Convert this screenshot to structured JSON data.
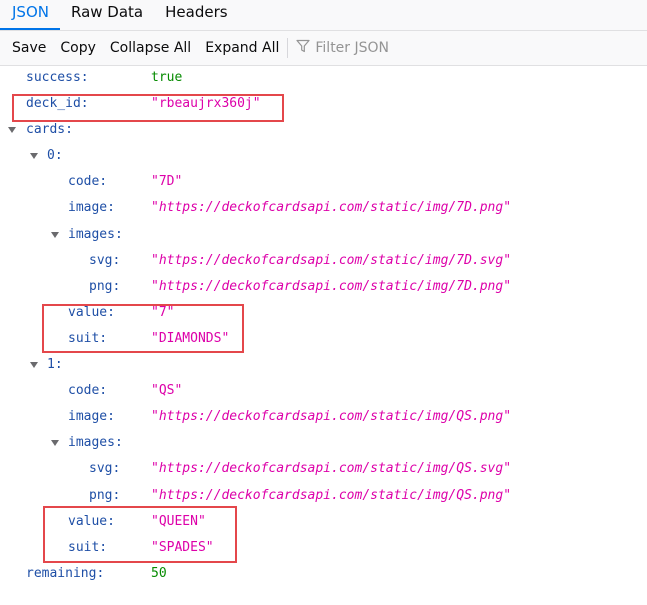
{
  "tabs": {
    "json": "JSON",
    "raw": "Raw Data",
    "headers": "Headers"
  },
  "toolbar": {
    "save": "Save",
    "copy": "Copy",
    "collapse_all": "Collapse All",
    "expand_all": "Expand All",
    "filter_placeholder": "Filter JSON"
  },
  "json": {
    "success": {
      "key": "success:",
      "value": "true"
    },
    "deck_id": {
      "key": "deck_id:",
      "value": "\"rbeaujrx360j\""
    },
    "cards": {
      "key": "cards:"
    },
    "card0": {
      "index": "0:",
      "code": {
        "key": "code:",
        "value": "\"7D\""
      },
      "image": {
        "key": "image:",
        "value": "\"https://deckofcardsapi.com/static/img/7D.png\""
      },
      "images": {
        "key": "images:"
      },
      "svg": {
        "key": "svg:",
        "value": "\"https://deckofcardsapi.com/static/img/7D.svg\""
      },
      "png": {
        "key": "png:",
        "value": "\"https://deckofcardsapi.com/static/img/7D.png\""
      },
      "value": {
        "key": "value:",
        "value": "\"7\""
      },
      "suit": {
        "key": "suit:",
        "value": "\"DIAMONDS\""
      }
    },
    "card1": {
      "index": "1:",
      "code": {
        "key": "code:",
        "value": "\"QS\""
      },
      "image": {
        "key": "image:",
        "value": "\"https://deckofcardsapi.com/static/img/QS.png\""
      },
      "images": {
        "key": "images:"
      },
      "svg": {
        "key": "svg:",
        "value": "\"https://deckofcardsapi.com/static/img/QS.svg\""
      },
      "png": {
        "key": "png:",
        "value": "\"https://deckofcardsapi.com/static/img/QS.png\""
      },
      "value": {
        "key": "value:",
        "value": "\"QUEEN\""
      },
      "suit": {
        "key": "suit:",
        "value": "\"SPADES\""
      }
    },
    "remaining": {
      "key": "remaining:",
      "value": "50"
    }
  },
  "colors": {
    "accent": "#0074e8",
    "key": "#1f4fa6",
    "string": "#dd00a9",
    "number_bool": "#058b00",
    "highlight_box": "#e4474b"
  },
  "icons": {
    "filter": "filter-icon",
    "twisty": "chevron-down-icon"
  }
}
